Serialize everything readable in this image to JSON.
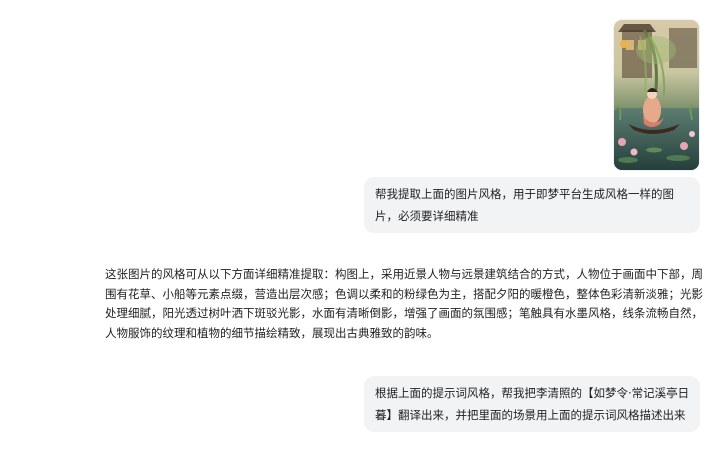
{
  "conversation": {
    "user_image": {
      "icon": "painting-image",
      "alt_label": ""
    },
    "user_message_1": "帮我提取上面的图片风格，用于即梦平台生成风格一样的图片，必须要详细精准",
    "assistant_message_1": "这张图片的风格可从以下方面详细精准提取：构图上，采用近景人物与远景建筑结合的方式，人物位于画面中下部，周围有花草、小船等元素点缀，营造出层次感；色调以柔和的粉绿色为主，搭配夕阳的暖橙色，整体色彩清新淡雅；光影处理细腻，阳光透过树叶洒下斑驳光影，水面有清晰倒影，增强了画面的氛围感；笔触具有水墨风格，线条流畅自然，人物服饰的纹理和植物的细节描绘精致，展现出古典雅致的韵味。",
    "user_message_2": "根据上面的提示词风格，帮我把李清照的【如梦令·常记溪亭日暮】翻译出来，并把里面的场景用上面的提示词风格描述出来"
  },
  "colors": {
    "bubble_bg": "#f2f3f5",
    "text": "#1f1f1f",
    "page_bg": "#ffffff"
  }
}
